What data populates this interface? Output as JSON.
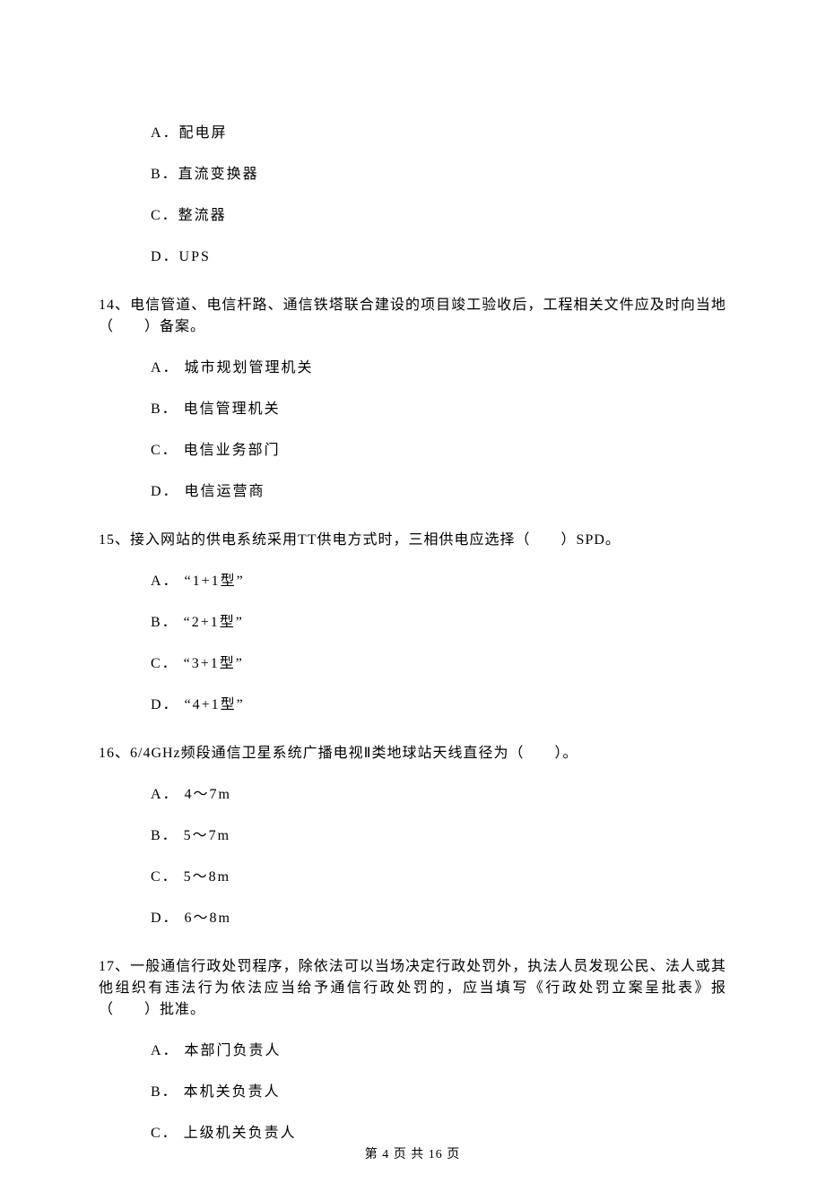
{
  "q13_options": {
    "a": "A．配电屏",
    "b": "B．直流变换器",
    "c": "C．整流器",
    "d": "D．UPS"
  },
  "q14": {
    "text": "14、电信管道、电信杆路、通信铁塔联合建设的项目竣工验收后，工程相关文件应及时向当地（　　）备案。",
    "a": "A． 城市规划管理机关",
    "b": "B． 电信管理机关",
    "c": "C． 电信业务部门",
    "d": "D． 电信运营商"
  },
  "q15": {
    "text": "15、接入网站的供电系统采用TT供电方式时，三相供电应选择（　　）SPD。",
    "a": "A． “1+1型”",
    "b": "B． “2+1型”",
    "c": "C． “3+1型”",
    "d": "D． “4+1型”"
  },
  "q16": {
    "text": "16、6/4GHz频段通信卫星系统广播电视Ⅱ类地球站天线直径为（　　）。",
    "a": "A． 4～7m",
    "b": "B． 5～7m",
    "c": "C． 5～8m",
    "d": "D． 6～8m"
  },
  "q17": {
    "text": "17、一般通信行政处罚程序，除依法可以当场决定行政处罚外，执法人员发现公民、法人或其他组织有违法行为依法应当给予通信行政处罚的，应当填写《行政处罚立案呈批表》报（　　）批准。",
    "a": "A． 本部门负责人",
    "b": "B． 本机关负责人",
    "c": "C． 上级机关负责人"
  },
  "footer": "第 4 页 共 16 页"
}
